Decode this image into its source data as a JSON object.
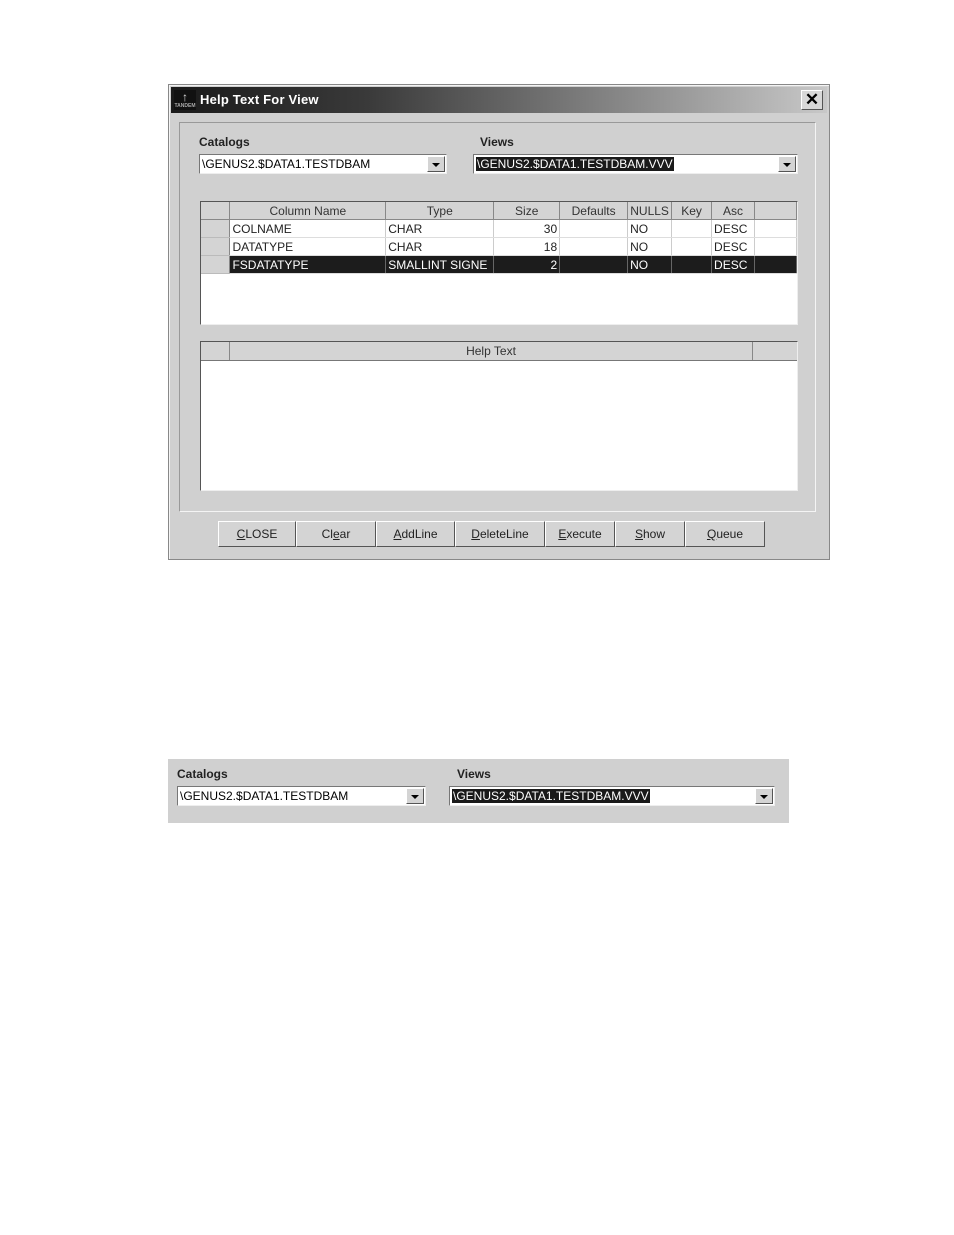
{
  "dialog": {
    "title": "Help Text  For View",
    "app_icon": "tandem-logo-icon",
    "close_icon": "close-icon",
    "catalogs": {
      "label": "Catalogs",
      "value": "\\GENUS2.$DATA1.TESTDBAM"
    },
    "views": {
      "label": "Views",
      "value": "\\GENUS2.$DATA1.TESTDBAM.VVV"
    },
    "columns_grid": {
      "headers": [
        "Column Name",
        "Type",
        "Size",
        "Defaults",
        "NULLS",
        "Key",
        "Asc"
      ],
      "rows": [
        {
          "name": "COLNAME",
          "type": "CHAR",
          "size": "30",
          "defaults": "",
          "nulls": "NO",
          "key": "",
          "asc": "DESC",
          "selected": false
        },
        {
          "name": "DATATYPE",
          "type": "CHAR",
          "size": "18",
          "defaults": "",
          "nulls": "NO",
          "key": "",
          "asc": "DESC",
          "selected": false
        },
        {
          "name": "FSDATATYPE",
          "type": "SMALLINT SIGNE",
          "size": "2",
          "defaults": "",
          "nulls": "NO",
          "key": "",
          "asc": "DESC",
          "selected": true
        }
      ]
    },
    "help_text": {
      "header": "Help Text",
      "content": ""
    },
    "buttons": [
      {
        "label": "CLOSE",
        "mnemonic": "C"
      },
      {
        "label": "Clear",
        "mnemonic": "e"
      },
      {
        "label": "AddLine",
        "mnemonic": "A"
      },
      {
        "label": "DeleteLine",
        "mnemonic": "D"
      },
      {
        "label": "Execute",
        "mnemonic": "E"
      },
      {
        "label": "Show",
        "mnemonic": "S"
      },
      {
        "label": "Queue",
        "mnemonic": "Q"
      }
    ]
  },
  "snippet": {
    "catalogs": {
      "label": "Catalogs",
      "value": "\\GENUS2.$DATA1.TESTDBAM"
    },
    "views": {
      "label": "Views",
      "value": "\\GENUS2.$DATA1.TESTDBAM.VVV"
    }
  }
}
